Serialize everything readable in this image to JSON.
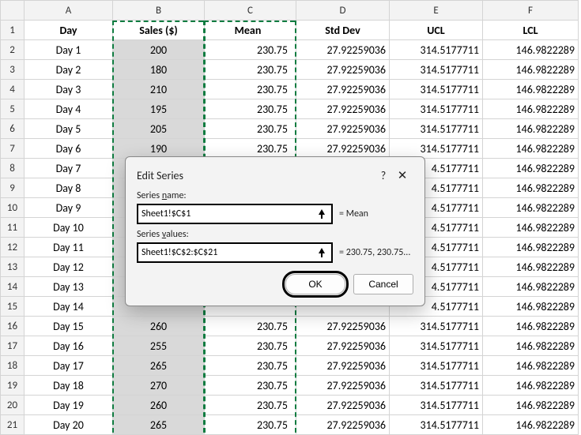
{
  "columns": {
    "A": "A",
    "B": "B",
    "C": "C",
    "D": "D",
    "E": "E",
    "F": "F"
  },
  "headers": {
    "A": "Day",
    "B": "Sales ($)",
    "C": "Mean",
    "D": "Std Dev",
    "E": "UCL",
    "F": "LCL"
  },
  "rows": [
    {
      "n": "1",
      "A": "Day",
      "B": "Sales ($)",
      "C": "Mean",
      "D": "Std Dev",
      "E": "UCL",
      "F": "LCL",
      "hdr": true
    },
    {
      "n": "2",
      "A": "Day 1",
      "B": "200",
      "C": "230.75",
      "D": "27.92259036",
      "E": "314.5177711",
      "F": "146.9822289"
    },
    {
      "n": "3",
      "A": "Day 2",
      "B": "180",
      "C": "230.75",
      "D": "27.92259036",
      "E": "314.5177711",
      "F": "146.9822289"
    },
    {
      "n": "4",
      "A": "Day 3",
      "B": "210",
      "C": "230.75",
      "D": "27.92259036",
      "E": "314.5177711",
      "F": "146.9822289"
    },
    {
      "n": "5",
      "A": "Day 4",
      "B": "195",
      "C": "230.75",
      "D": "27.92259036",
      "E": "314.5177711",
      "F": "146.9822289"
    },
    {
      "n": "6",
      "A": "Day 5",
      "B": "205",
      "C": "230.75",
      "D": "27.92259036",
      "E": "314.5177711",
      "F": "146.9822289"
    },
    {
      "n": "7",
      "A": "Day 6",
      "B": "190",
      "C": "230.75",
      "D": "27.92259036",
      "E": "314.5177711",
      "F": "146.9822289"
    },
    {
      "n": "8",
      "A": "Day 7",
      "B": "",
      "C": "",
      "D": "",
      "E": "4.5177711",
      "F": "146.9822289"
    },
    {
      "n": "9",
      "A": "Day 8",
      "B": "",
      "C": "",
      "D": "",
      "E": "4.5177711",
      "F": "146.9822289"
    },
    {
      "n": "10",
      "A": "Day 9",
      "B": "",
      "C": "",
      "D": "",
      "E": "4.5177711",
      "F": "146.9822289"
    },
    {
      "n": "11",
      "A": "Day 10",
      "B": "",
      "C": "",
      "D": "",
      "E": "4.5177711",
      "F": "146.9822289"
    },
    {
      "n": "12",
      "A": "Day 11",
      "B": "",
      "C": "",
      "D": "",
      "E": "4.5177711",
      "F": "146.9822289"
    },
    {
      "n": "13",
      "A": "Day 12",
      "B": "",
      "C": "",
      "D": "",
      "E": "4.5177711",
      "F": "146.9822289"
    },
    {
      "n": "14",
      "A": "Day 13",
      "B": "",
      "C": "",
      "D": "",
      "E": "4.5177711",
      "F": "146.9822289"
    },
    {
      "n": "15",
      "A": "Day 14",
      "B": "",
      "C": "",
      "D": "",
      "E": "4.5177711",
      "F": "146.9822289"
    },
    {
      "n": "16",
      "A": "Day 15",
      "B": "260",
      "C": "230.75",
      "D": "27.92259036",
      "E": "314.5177711",
      "F": "146.9822289"
    },
    {
      "n": "17",
      "A": "Day 16",
      "B": "255",
      "C": "230.75",
      "D": "27.92259036",
      "E": "314.5177711",
      "F": "146.9822289"
    },
    {
      "n": "18",
      "A": "Day 17",
      "B": "265",
      "C": "230.75",
      "D": "27.92259036",
      "E": "314.5177711",
      "F": "146.9822289"
    },
    {
      "n": "19",
      "A": "Day 18",
      "B": "270",
      "C": "230.75",
      "D": "27.92259036",
      "E": "314.5177711",
      "F": "146.9822289"
    },
    {
      "n": "20",
      "A": "Day 19",
      "B": "260",
      "C": "230.75",
      "D": "27.92259036",
      "E": "314.5177711",
      "F": "146.9822289"
    },
    {
      "n": "21",
      "A": "Day 20",
      "B": "265",
      "C": "230.75",
      "D": "27.92259036",
      "E": "314.5177711",
      "F": "146.9822289"
    }
  ],
  "dialog": {
    "title": "Edit Series",
    "help": "?",
    "close": "✕",
    "name_label": "Series name:",
    "name_value": "Sheet1!$C$1",
    "name_eq": "= Mean",
    "values_label": "Series values:",
    "values_value": "Sheet1!$C$2:$C$21",
    "values_eq": "= 230.75, 230.75...",
    "ok": "OK",
    "cancel": "Cancel"
  }
}
